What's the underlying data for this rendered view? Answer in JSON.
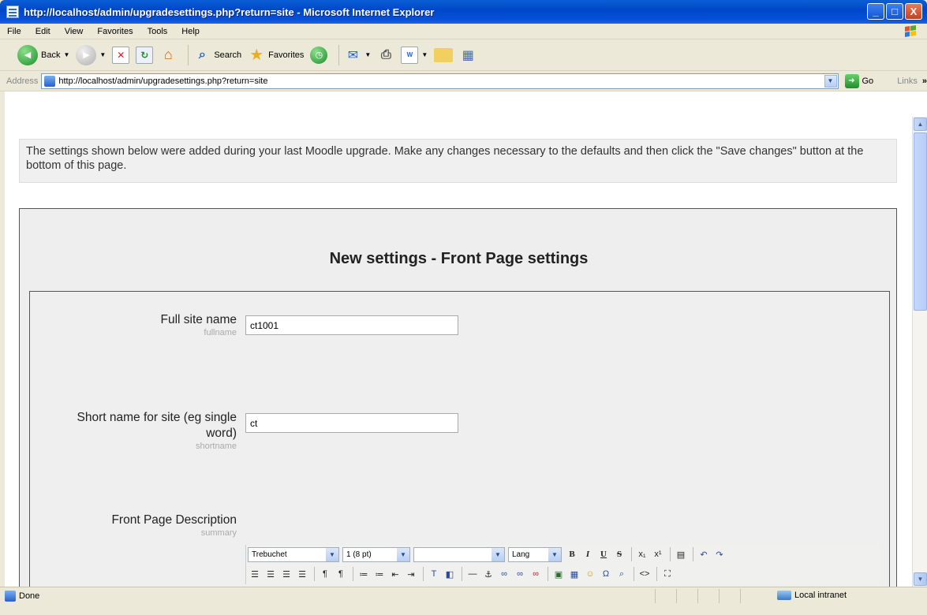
{
  "window": {
    "title": "http://localhost/admin/upgradesettings.php?return=site - Microsoft Internet Explorer",
    "minimize": "_",
    "maximize": "□",
    "close": "X"
  },
  "menu": [
    "File",
    "Edit",
    "View",
    "Favorites",
    "Tools",
    "Help"
  ],
  "toolbar": {
    "back": "Back",
    "search": "Search",
    "favorites": "Favorites"
  },
  "address": {
    "label": "Address",
    "url": "http://localhost/admin/upgradesettings.php?return=site",
    "go": "Go",
    "links": "Links",
    "links_more": "»"
  },
  "page": {
    "notice": "The settings shown below were added during your last Moodle upgrade. Make any changes necessary to the defaults and then click the \"Save changes\" button at the bottom of this page.",
    "heading": "New settings - Front Page settings",
    "settings": [
      {
        "label": "Full site name",
        "sub": "fullname",
        "value": "ct1001"
      },
      {
        "label": "Short name for site (eg single word)",
        "sub": "shortname",
        "value": "ct"
      },
      {
        "label": "Front Page Description",
        "sub": "summary"
      }
    ],
    "editor": {
      "font": "Trebuchet",
      "size": "1 (8 pt)",
      "heading": "",
      "lang": "Lang"
    }
  },
  "status": {
    "left": "Done",
    "zone": "Local intranet"
  },
  "colors": {
    "titlebar": "#0350d8",
    "chrome": "#ece9d8",
    "settings_bg": "#eeeeee"
  }
}
